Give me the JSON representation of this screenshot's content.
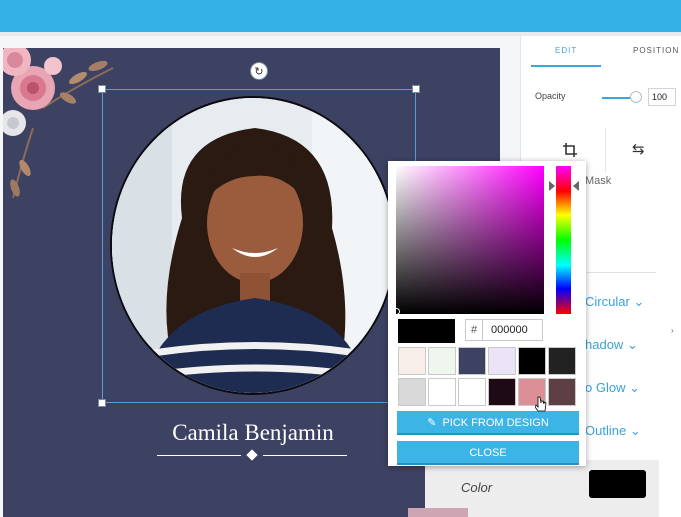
{
  "panel": {
    "tabs": [
      "EDIT",
      "POSITION"
    ],
    "opacity_label": "Opacity",
    "opacity_value": "100",
    "mask_label": "Mask",
    "effects": [
      "Circular",
      "hadow",
      "o Glow",
      "Outline"
    ],
    "color_label": "Color",
    "color_value": "#000000"
  },
  "design": {
    "name": "Camila Benjamin",
    "background": "#3d4263"
  },
  "picker": {
    "hash": "#",
    "hex_value": "000000",
    "pick_label": "PICK FROM DESIGN",
    "close_label": "CLOSE",
    "swatches": [
      "#f7ede9",
      "#eef6ee",
      "#3d4263",
      "#ebe4f8",
      "#000000",
      "#222222",
      "#d9d9d9",
      "#ffffff",
      "#ffffff",
      "#1e0a14",
      "#dd8f97",
      "#5e3f45"
    ]
  },
  "colors": {
    "accent": "#33b0e6",
    "button": "#3cb5e6"
  }
}
